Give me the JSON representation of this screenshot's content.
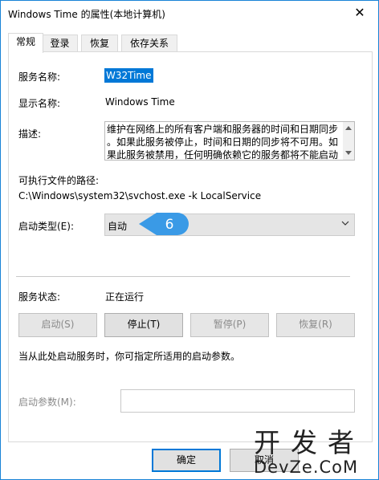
{
  "window": {
    "title": "Windows Time 的属性(本地计算机)",
    "close_glyph": "✕"
  },
  "tabs": [
    {
      "label": "常规",
      "active": true
    },
    {
      "label": "登录",
      "active": false
    },
    {
      "label": "恢复",
      "active": false
    },
    {
      "label": "依存关系",
      "active": false
    }
  ],
  "fields": {
    "service_name_label": "服务名称:",
    "service_name_value": "W32Time",
    "display_name_label": "显示名称:",
    "display_name_value": "Windows Time",
    "description_label": "描述:",
    "description_lines": [
      "维护在网络上的所有客户端和服务器的时间和日期同步",
      "。如果此服务被停止，时间和日期的同步将不可用。如",
      "果此服务被禁用，任何明确依赖它的服务都将不能启动"
    ],
    "exe_path_label": "可执行文件的路径:",
    "exe_path_value": "C:\\Windows\\system32\\svchost.exe -k LocalService",
    "startup_type_label": "启动类型(E):",
    "startup_type_value": "自动",
    "annotation_number": "6",
    "service_status_label": "服务状态:",
    "service_status_value": "正在运行"
  },
  "buttons": {
    "start": "启动(S)",
    "stop": "停止(T)",
    "pause": "暂停(P)",
    "resume": "恢复(R)",
    "ok": "确定",
    "cancel": "取消"
  },
  "hint_text": "当从此处启动服务时，你可指定所适用的启动参数。",
  "start_params_label": "启动参数(M):",
  "start_params_value": "",
  "watermark": {
    "line1": "开发者",
    "line2": "DevZe.CoM"
  },
  "colors": {
    "accent": "#0078d7",
    "badge": "#3a9ae6",
    "window_border": "#1883d7"
  }
}
